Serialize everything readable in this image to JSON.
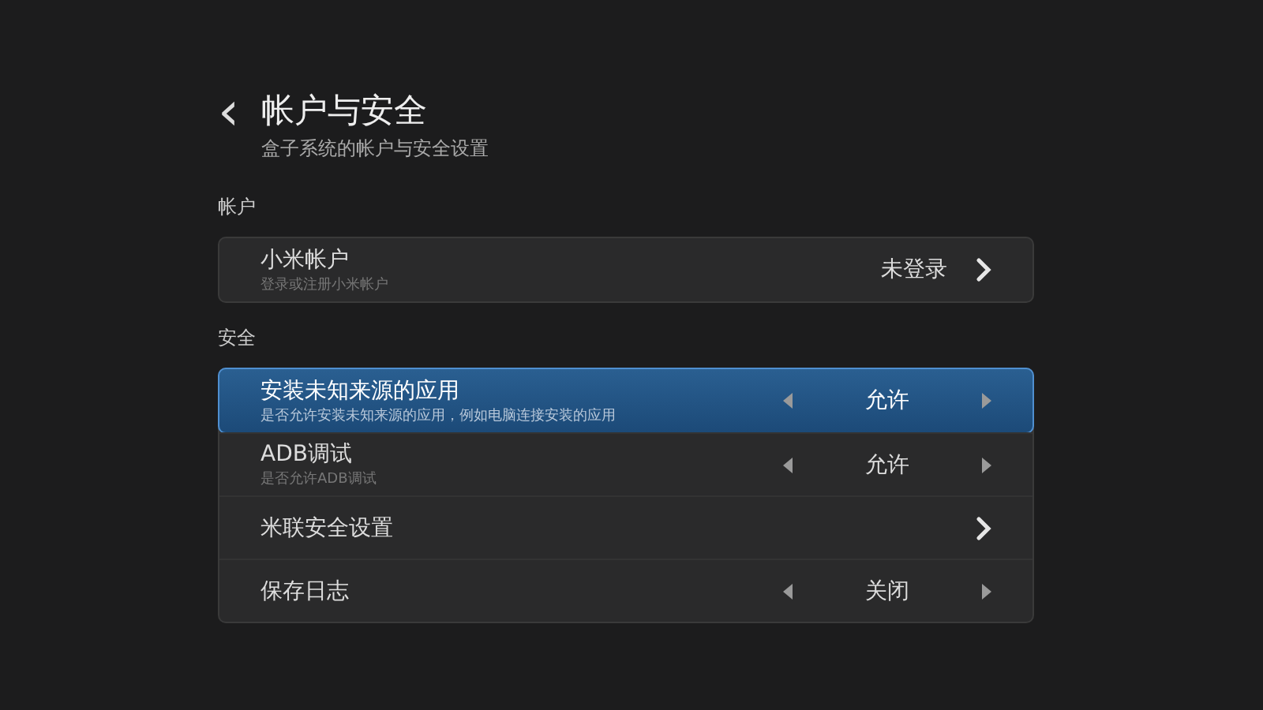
{
  "header": {
    "back": "‹",
    "title": "帐户与安全",
    "subtitle": "盒子系统的帐户与安全设置"
  },
  "sections": [
    {
      "title": "帐户",
      "items": [
        {
          "kind": "link",
          "label": "小米帐户",
          "description": "登录或注册小米帐户",
          "value": "未登录",
          "selected": false
        }
      ]
    },
    {
      "title": "安全",
      "items": [
        {
          "kind": "choice",
          "label": "安装未知来源的应用",
          "description": "是否允许安装未知来源的应用，例如电脑连接安装的应用",
          "value": "允许",
          "selected": true
        },
        {
          "kind": "choice",
          "label": "ADB调试",
          "description": "是否允许ADB调试",
          "value": "允许",
          "selected": false
        },
        {
          "kind": "link",
          "label": "米联安全设置",
          "selected": false
        },
        {
          "kind": "choice",
          "label": "保存日志",
          "value": "关闭",
          "selected": false
        }
      ]
    }
  ]
}
